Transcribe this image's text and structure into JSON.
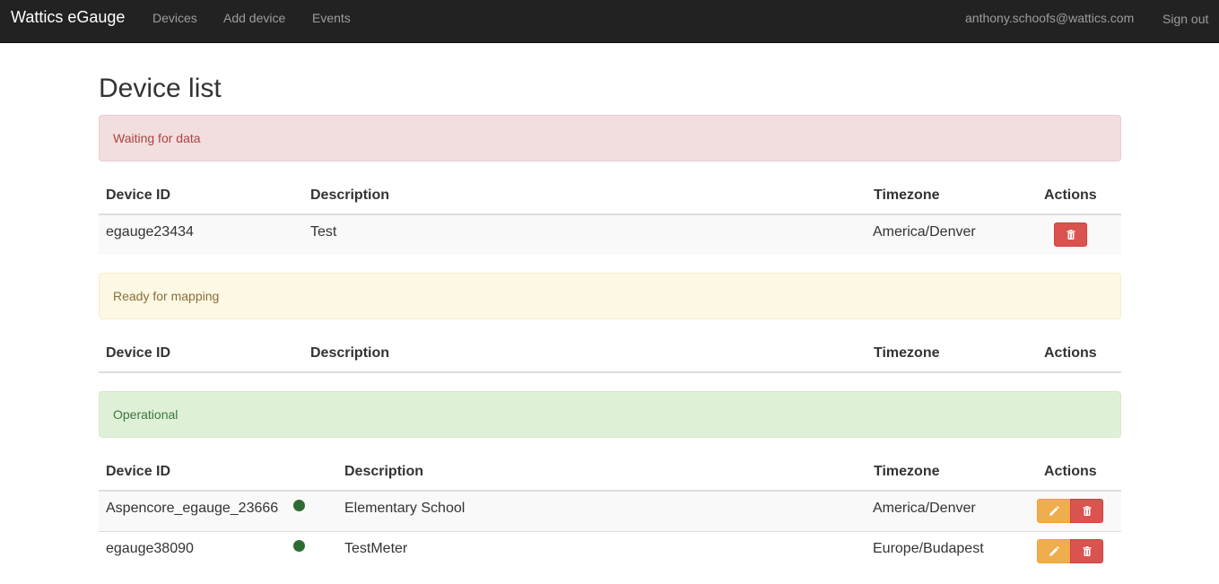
{
  "navbar": {
    "brand": "Wattics eGauge",
    "links": [
      "Devices",
      "Add device",
      "Events"
    ],
    "user_email": "anthony.schoofs@wattics.com",
    "sign_out": "Sign out"
  },
  "page_title": "Device list",
  "sections": [
    {
      "status": "Waiting for data",
      "headers": [
        "Device ID",
        "Description",
        "Timezone",
        "Actions"
      ],
      "rows": [
        {
          "device_id": "egauge23434",
          "description": "Test",
          "timezone": "America/Denver",
          "actions": [
            "delete-icon"
          ]
        }
      ]
    },
    {
      "status": "Ready for mapping",
      "headers": [
        "Device ID",
        "Description",
        "Timezone",
        "Actions"
      ],
      "rows": []
    },
    {
      "status": "Operational",
      "headers": [
        "Device ID",
        "Description",
        "Timezone",
        "Actions"
      ],
      "rows": [
        {
          "device_id": "Aspencore_egauge_23666",
          "status_icon": "online-dot-icon",
          "description": "Elementary School",
          "timezone": "America/Denver",
          "actions": [
            "edit-icon",
            "delete-icon"
          ]
        },
        {
          "device_id": "egauge38090",
          "status_icon": "online-dot-icon",
          "description": "TestMeter",
          "timezone": "Europe/Budapest",
          "actions": [
            "edit-icon",
            "delete-icon"
          ]
        }
      ]
    }
  ],
  "colors": {
    "navbar_bg": "#222222",
    "danger": "#d9534f",
    "warning": "#f0ad4e",
    "online_dot": "#2e6b33"
  }
}
